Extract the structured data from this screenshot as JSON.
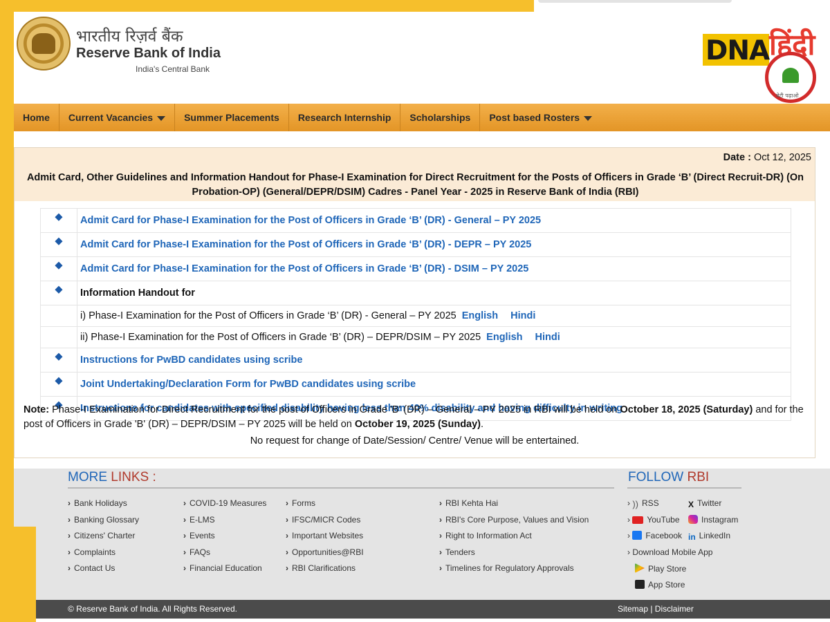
{
  "header": {
    "hindi_name": "भारतीय रिज़र्व बैंक",
    "english_name": "Reserve Bank of India",
    "tagline": "India's Central Bank",
    "dna_brand": "DNA",
    "dna_hindi": "हिंदी",
    "dna_small": "बेटी पढ़ाओ"
  },
  "nav": {
    "items": [
      {
        "label": "Home"
      },
      {
        "label": "Current Vacancies"
      },
      {
        "label": "Summer Placements"
      },
      {
        "label": "Research Internship"
      },
      {
        "label": "Scholarships"
      },
      {
        "label": "Post based Rosters"
      }
    ]
  },
  "notice": {
    "date_label": "Date :",
    "date_value": "Oct 12, 2025",
    "title": "Admit Card, Other Guidelines and Information Handout for Phase-I Examination for Direct Recruitment for the Posts of Officers in Grade ‘B’ (Direct Recruit-DR) (On Probation-OP) (General/DEPR/DSIM) Cadres - Panel Year - 2025 in Reserve Bank of India (RBI)",
    "rows": [
      "Admit Card for Phase-I Examination for the Post of Officers in Grade ‘B’ (DR) - General – PY 2025",
      "Admit Card for Phase-I Examination for the Post of Officers in Grade ‘B’ (DR) - DEPR – PY 2025",
      "Admit Card for Phase-I Examination for the Post of Officers in Grade ‘B’ (DR) - DSIM – PY 2025",
      "Information Handout for",
      "i) Phase-I Examination for the Post of Officers in Grade ‘B’ (DR) - General – PY 2025",
      "ii) Phase-I Examination for the Post of Officers in Grade ‘B’ (DR) – DEPR/DSIM – PY 2025",
      "Instructions for PwBD candidates using scribe",
      "Joint Undertaking/Declaration Form for PwBD candidates using scribe",
      "Instructions for candidates with specified disability having less than 40% disability and having difficulty in writing"
    ],
    "english": "English",
    "hindi": "Hindi",
    "note_label": "Note:",
    "note_1": " Phase-I Examination for Direct Recruitment for the post of Officers in Grade 'B' (DR) – General – PY 2025 in RBI will be held on ",
    "note_date1": "October 18, 2025 (Saturday)",
    "note_2": " and for the post of Officers in Grade 'B' (DR) – DEPR/DSIM – PY 2025 will be held on ",
    "note_date2": "October 19, 2025 (Sunday)",
    "note_3": ".",
    "no_request": "No request for change of Date/Session/ Centre/ Venue will be entertained."
  },
  "footer": {
    "more": "MORE",
    "links_word": "LINKS :",
    "follow": "FOLLOW",
    "rbi_word": "RBI",
    "col1": [
      "Bank Holidays",
      "Banking Glossary",
      "Citizens' Charter",
      "Complaints",
      "Contact Us"
    ],
    "col2": [
      "COVID-19 Measures",
      "E-LMS",
      "Events",
      "FAQs",
      "Financial Education"
    ],
    "col3": [
      "Forms",
      "IFSC/MICR Codes",
      "Important Websites",
      "Opportunities@RBI",
      "RBI Clarifications"
    ],
    "col4": [
      "RBI Kehta Hai",
      "RBI's Core Purpose, Values and Vision",
      "Right to Information Act",
      "Tenders",
      "Timelines for Regulatory Approvals"
    ],
    "social": {
      "rss": "RSS",
      "twitter": "Twitter",
      "youtube": "YouTube",
      "instagram": "Instagram",
      "facebook": "Facebook",
      "linkedin": "LinkedIn",
      "download": "Download Mobile App",
      "play": "Play Store",
      "app": "App Store"
    },
    "copyright": "© Reserve Bank of India. All Rights Reserved.",
    "sitemap": "Sitemap | Disclaimer"
  },
  "colors": {
    "accent_yellow": "#f6bf2c",
    "nav_orange": "#e39526",
    "link_blue": "#1f66b8",
    "heading_red": "#b0392b"
  }
}
